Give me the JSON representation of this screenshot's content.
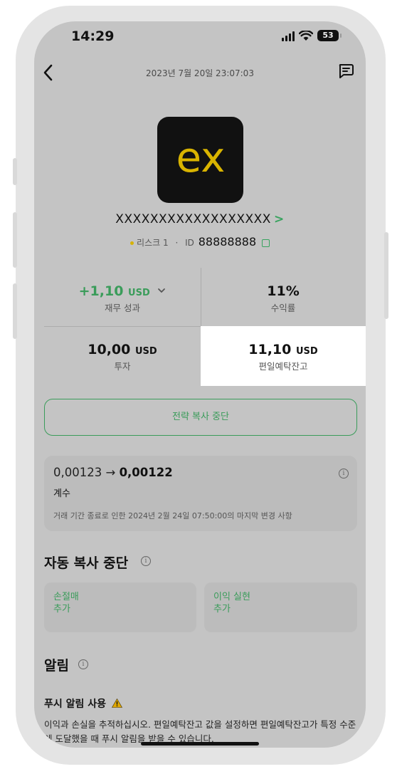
{
  "status_bar": {
    "time": "14:29",
    "battery": "53"
  },
  "header": {
    "title": "2023년 7월 20일 23:07:03"
  },
  "logo": {
    "text": "ex",
    "color": "#d9b400"
  },
  "account": {
    "name": "XXXXXXXXXXXXXXXXXX",
    "chevron": ">",
    "risk": "리스크 1",
    "separator": "·",
    "id_label": "ID",
    "id_value": "88888888"
  },
  "stats": {
    "financial_result": {
      "value": "+1,10",
      "unit": "USD",
      "label": "재무 성과"
    },
    "return": {
      "value": "11%",
      "label": "수익률"
    },
    "investment": {
      "value": "10,00",
      "unit": "USD",
      "label": "투자"
    },
    "equity": {
      "value": "11,10",
      "unit": "USD",
      "label": "편일예탁잔고"
    }
  },
  "stop_button": {
    "label": "전략 복사 중단"
  },
  "coefficient": {
    "from": "0,00123",
    "arrow": "→",
    "to": "0,00122",
    "label": "계수",
    "note": "거래 기간 종료로 인한 2024년 2월 24일 07:50:00의 마지막 변경 사항"
  },
  "auto_stop": {
    "title": "자동 복사 중단",
    "stop_loss": {
      "line1": "손절매",
      "line2": "추가"
    },
    "take_profit": {
      "line1": "이익 실현",
      "line2": "추가"
    }
  },
  "alerts": {
    "title": "알림",
    "push_title": "푸시 알림 사용",
    "push_text": "이익과 손실을 추적하십시오. 편일예탁잔고 값을 설정하면 편일예탁잔고가 특정 수준에 도달했을 때 푸시 알림을 받을 수 있습니다."
  },
  "colors": {
    "accent": "#3a9c5a",
    "screen": "#c4c4c4",
    "logo_bg": "#111111"
  }
}
